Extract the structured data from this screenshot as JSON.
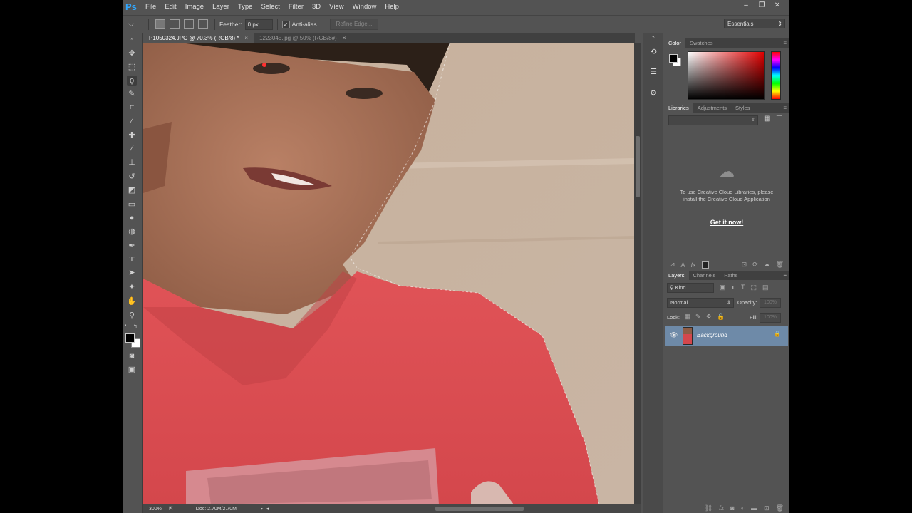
{
  "app": {
    "logo": "Ps"
  },
  "menu": [
    "File",
    "Edit",
    "Image",
    "Layer",
    "Type",
    "Select",
    "Filter",
    "3D",
    "View",
    "Window",
    "Help"
  ],
  "window_controls": {
    "minimize": "–",
    "restore": "❐",
    "close": "✕"
  },
  "options": {
    "feather_label": "Feather:",
    "feather_value": "0 px",
    "antialias_label": "Anti-alias",
    "refine_edge": "Refine Edge...",
    "workspace": "Essentials"
  },
  "tabs": [
    {
      "label": "P1050324.JPG @ 70.3% (RGB/8) *",
      "close": "×"
    },
    {
      "label": "1223045.jpg @ 50% (RGB/8#)",
      "close": "×"
    }
  ],
  "status": {
    "zoom": "300%",
    "doc": "Doc: 2.70M/2.70M"
  },
  "color_panel": {
    "tabs": [
      "Color",
      "Swatches"
    ],
    "foreground": "#000000",
    "background": "#ffffff"
  },
  "libraries_panel": {
    "tabs": [
      "Libraries",
      "Adjustments",
      "Styles"
    ],
    "message": "To use Creative Cloud Libraries, please install the Creative Cloud Application",
    "link": "Get it now!"
  },
  "layers_panel": {
    "tabs": [
      "Layers",
      "Channels",
      "Paths"
    ],
    "kind_label": "Kind",
    "blend_mode": "Normal",
    "opacity_label": "Opacity:",
    "opacity_value": "100%",
    "lock_label": "Lock:",
    "fill_label": "Fill:",
    "fill_value": "100%",
    "layers": [
      {
        "name": "Background",
        "visible": true,
        "locked": true
      }
    ]
  },
  "colors": {
    "accent": "#31a8ff",
    "ui_bg": "#535353",
    "selected_layer": "#6e8aa8"
  }
}
